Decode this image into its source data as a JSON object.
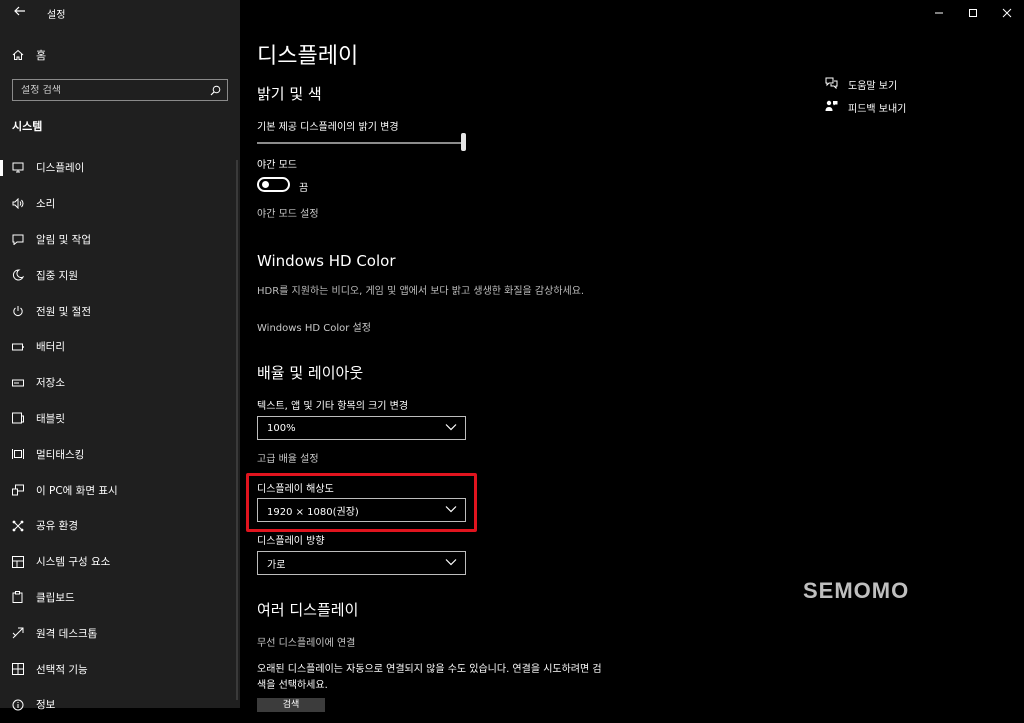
{
  "window": {
    "title": "설정"
  },
  "sidebar": {
    "home_label": "홈",
    "search_placeholder": "설정 검색",
    "section_label": "시스템",
    "items": [
      {
        "label": "디스플레이",
        "icon": "monitor-icon"
      },
      {
        "label": "소리",
        "icon": "speaker-icon"
      },
      {
        "label": "알림 및 작업",
        "icon": "notification-icon"
      },
      {
        "label": "집중 지원",
        "icon": "moon-icon"
      },
      {
        "label": "전원 및 절전",
        "icon": "power-icon"
      },
      {
        "label": "배터리",
        "icon": "battery-icon"
      },
      {
        "label": "저장소",
        "icon": "storage-icon"
      },
      {
        "label": "태블릿",
        "icon": "tablet-icon"
      },
      {
        "label": "멀티태스킹",
        "icon": "multitask-icon"
      },
      {
        "label": "이 PC에 화면 표시",
        "icon": "project-icon"
      },
      {
        "label": "공유 환경",
        "icon": "share-icon"
      },
      {
        "label": "시스템 구성 요소",
        "icon": "components-icon"
      },
      {
        "label": "클립보드",
        "icon": "clipboard-icon"
      },
      {
        "label": "원격 데스크톱",
        "icon": "remote-icon"
      },
      {
        "label": "선택적 기능",
        "icon": "features-icon"
      },
      {
        "label": "정보",
        "icon": "info-icon"
      }
    ]
  },
  "main": {
    "title": "디스플레이",
    "brightness": {
      "heading": "밝기 및 색",
      "label": "기본 제공 디스플레이의 밝기 변경",
      "value_percent": 100
    },
    "night_light": {
      "label": "야간 모드",
      "state": "끔",
      "settings_link": "야간 모드 설정"
    },
    "hdr": {
      "heading": "Windows HD Color",
      "description": "HDR를 지원하는 비디오, 게임 및 앱에서 보다 밝고 생생한 화질을 감상하세요.",
      "settings_link": "Windows HD Color 설정"
    },
    "scale": {
      "heading": "배율 및 레이아웃",
      "label": "텍스트, 앱 및 기타 항목의 크기 변경",
      "value": "100%",
      "advanced_link": "고급 배율 설정"
    },
    "resolution": {
      "label": "디스플레이 해상도",
      "value": "1920 × 1080(권장)"
    },
    "orientation": {
      "label": "디스플레이 방향",
      "value": "가로"
    },
    "multiple": {
      "heading": "여러 디스플레이",
      "wireless_link": "무선 디스플레이에 연결",
      "description": "오래된 디스플레이는 자동으로 연결되지 않을 수도 있습니다. 연결을 시도하려면 검색을 선택하세요.",
      "detect_button": "검색"
    }
  },
  "right_panel": {
    "help": "도움말 보기",
    "feedback": "피드백 보내기"
  },
  "watermark": "SEMOMO",
  "colors": {
    "highlight": "#e0141e",
    "sidebar_bg": "#1f1f1f",
    "main_bg": "#000000"
  }
}
